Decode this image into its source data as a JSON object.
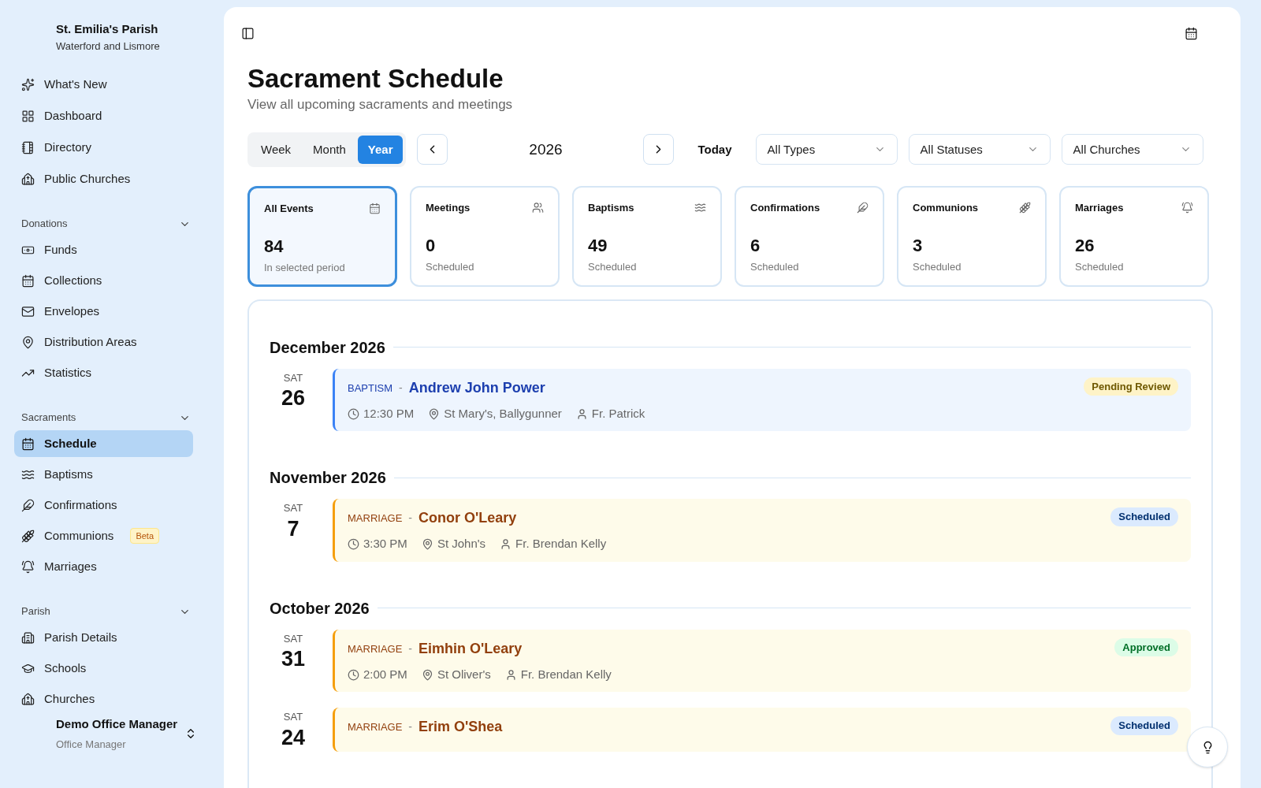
{
  "parish": {
    "name": "St. Emilia's Parish",
    "diocese": "Waterford and Lismore"
  },
  "nav_top": [
    {
      "label": "What's New",
      "kind": "sparkles",
      "selected": false
    },
    {
      "label": "Dashboard",
      "kind": "dashboard",
      "selected": false
    },
    {
      "label": "Directory",
      "kind": "book",
      "selected": false
    },
    {
      "label": "Public Churches",
      "kind": "church",
      "selected": false
    }
  ],
  "nav_sections": [
    {
      "title": "Donations",
      "expanded": true,
      "items": [
        {
          "label": "Funds",
          "kind": "banknote",
          "selected": false
        },
        {
          "label": "Collections",
          "kind": "calendar",
          "selected": false
        },
        {
          "label": "Envelopes",
          "kind": "mail",
          "selected": false
        },
        {
          "label": "Distribution Areas",
          "kind": "pin",
          "selected": false
        },
        {
          "label": "Statistics",
          "kind": "trend",
          "selected": false
        }
      ]
    },
    {
      "title": "Sacraments",
      "expanded": true,
      "items": [
        {
          "label": "Schedule",
          "kind": "calendar",
          "selected": true
        },
        {
          "label": "Baptisms",
          "kind": "waves",
          "selected": false
        },
        {
          "label": "Confirmations",
          "kind": "feather",
          "selected": false
        },
        {
          "label": "Communions",
          "kind": "wheat",
          "selected": false,
          "badge": "Beta"
        },
        {
          "label": "Marriages",
          "kind": "bell",
          "selected": false
        }
      ]
    },
    {
      "title": "Parish",
      "expanded": true,
      "items": [
        {
          "label": "Parish Details",
          "kind": "building",
          "selected": false
        },
        {
          "label": "Schools",
          "kind": "school",
          "selected": false
        },
        {
          "label": "Churches",
          "kind": "church",
          "selected": false
        }
      ]
    }
  ],
  "user": {
    "name": "Demo Office Manager",
    "role": "Office Manager"
  },
  "page": {
    "title": "Sacrament Schedule",
    "subtitle": "View all upcoming sacraments and meetings"
  },
  "views": [
    {
      "label": "Week",
      "selected": false
    },
    {
      "label": "Month",
      "selected": false
    },
    {
      "label": "Year",
      "selected": true
    }
  ],
  "period": "2026",
  "today_button": "Today",
  "filters": [
    "All Types",
    "All Statuses",
    "All Churches"
  ],
  "stat_cards": [
    {
      "title": "All Events",
      "kind": "calendar",
      "value": "84",
      "caption": "In selected period",
      "selected": true
    },
    {
      "title": "Meetings",
      "kind": "users",
      "value": "0",
      "caption": "Scheduled",
      "selected": false
    },
    {
      "title": "Baptisms",
      "kind": "waves",
      "value": "49",
      "caption": "Scheduled",
      "selected": false
    },
    {
      "title": "Confirmations",
      "kind": "feather",
      "value": "6",
      "caption": "Scheduled",
      "selected": false
    },
    {
      "title": "Communions",
      "kind": "wheat",
      "value": "3",
      "caption": "Scheduled",
      "selected": false
    },
    {
      "title": "Marriages",
      "kind": "bell",
      "value": "26",
      "caption": "Scheduled",
      "selected": false
    }
  ],
  "months": [
    {
      "title": "December 2026",
      "events": [
        {
          "weekday": "SAT",
          "day": "26",
          "kind": "baptism",
          "type": "BAPTISM",
          "separator": "-",
          "name": "Andrew John Power",
          "time": "12:30 PM",
          "place": "St Mary's, Ballygunner",
          "priest": "Fr. Patrick",
          "status": "Pending Review",
          "color": "#fef3c7"
        }
      ]
    },
    {
      "title": "November 2026",
      "events": [
        {
          "weekday": "SAT",
          "day": "7",
          "kind": "marriage",
          "type": "MARRIAGE",
          "separator": "-",
          "name": "Conor O'Leary",
          "time": "3:30 PM",
          "place": "St John's",
          "priest": "Fr. Brendan Kelly",
          "status": "Scheduled",
          "color": "#dbeafe"
        }
      ]
    },
    {
      "title": "October 2026",
      "events": [
        {
          "weekday": "SAT",
          "day": "31",
          "kind": "marriage",
          "type": "MARRIAGE",
          "separator": "-",
          "name": "Eimhin O'Leary",
          "time": "2:00 PM",
          "place": "St Oliver's",
          "priest": "Fr. Brendan Kelly",
          "status": "Approved",
          "color": "#dcfce7"
        },
        {
          "weekday": "SAT",
          "day": "24",
          "kind": "marriage",
          "type": "MARRIAGE",
          "separator": "-",
          "name": "Erim O'Shea",
          "status": "Scheduled",
          "color": "#dbeafe"
        }
      ]
    }
  ]
}
